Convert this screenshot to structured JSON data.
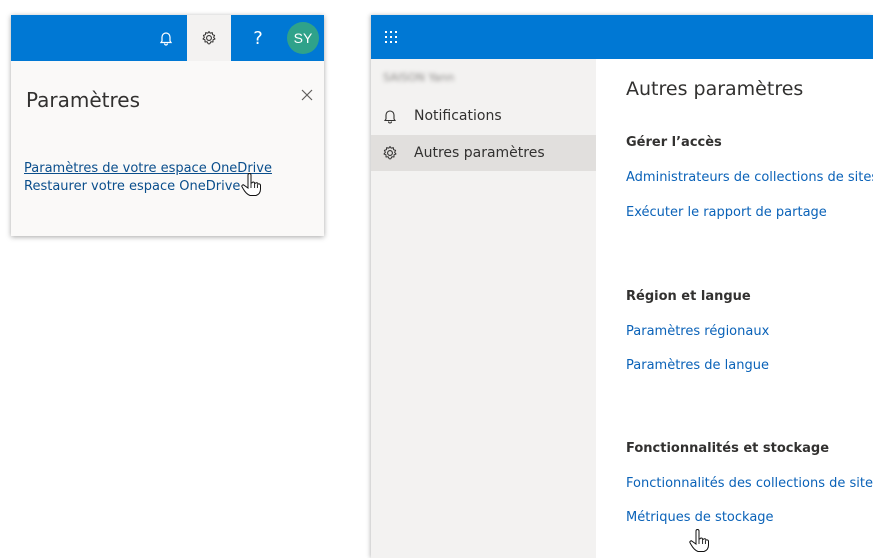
{
  "settings_panel": {
    "title": "Paramètres",
    "links": [
      "Paramètres de votre espace OneDrive",
      "Restaurer votre espace OneDrive"
    ],
    "avatar_initials": "SY",
    "help_label": "?"
  },
  "settings_page": {
    "user_name": "SAISON Yann",
    "sidebar_items": [
      {
        "label": "Notifications",
        "icon": "bell-icon"
      },
      {
        "label": "Autres paramètres",
        "icon": "gear-icon",
        "selected": true
      }
    ],
    "title": "Autres paramètres",
    "sections": [
      {
        "title": "Gérer l’accès",
        "links": [
          "Administrateurs de collections de sites",
          "Exécuter le rapport de partage"
        ]
      },
      {
        "title": "Région et langue",
        "links": [
          "Paramètres régionaux",
          "Paramètres de langue"
        ]
      },
      {
        "title": "Fonctionnalités et stockage",
        "links": [
          "Fonctionnalités des collections de sites",
          "Métriques de stockage"
        ]
      }
    ]
  },
  "colors": {
    "brand_blue": "#0078d4",
    "avatar_green": "#2fa28a",
    "link_blue": "#0a62b8"
  }
}
